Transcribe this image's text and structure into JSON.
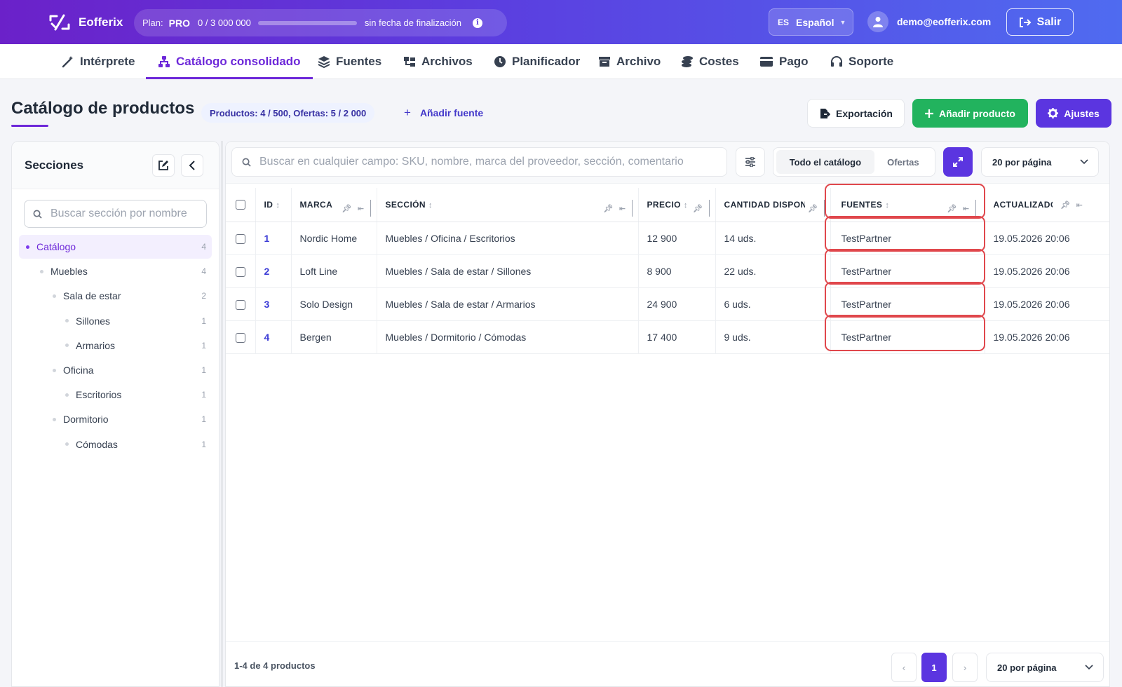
{
  "app": {
    "name": "Eofferix"
  },
  "plan": {
    "label": "Plan:",
    "tier": "PRO",
    "usage": "0  /  3 000 000",
    "usage_fraction": 0,
    "expiry": "sin fecha de finalización"
  },
  "lang": {
    "code": "ES",
    "name": "Español"
  },
  "user": {
    "email": "demo@eofferix.com",
    "logout": "Salir"
  },
  "nav": {
    "items": [
      {
        "label": "Intérprete",
        "icon": "magic-wand-icon"
      },
      {
        "label": "Catálogo consolidado",
        "icon": "sitemap-icon"
      },
      {
        "label": "Fuentes",
        "icon": "layers-icon"
      },
      {
        "label": "Archivos",
        "icon": "folder-tree-icon"
      },
      {
        "label": "Planificador",
        "icon": "clock-icon"
      },
      {
        "label": "Archivo",
        "icon": "archive-box-icon"
      },
      {
        "label": "Costes",
        "icon": "coins-icon"
      },
      {
        "label": "Pago",
        "icon": "credit-card-icon"
      },
      {
        "label": "Soporte",
        "icon": "headset-icon"
      }
    ],
    "active": "Catálogo consolidado"
  },
  "page": {
    "title": "Catálogo de productos",
    "counts": "Productos: 4 / 500, Ofertas: 5 / 2 000",
    "add_source": "Añadir fuente",
    "export": "Exportación",
    "add_product": "Añadir producto",
    "settings": "Ajustes"
  },
  "sidebar": {
    "title": "Secciones",
    "search_placeholder": "Buscar sección por nombre",
    "tree": [
      {
        "label": "Catálogo",
        "count": "4",
        "depth": 0,
        "active": true
      },
      {
        "label": "Muebles",
        "count": "4",
        "depth": 1
      },
      {
        "label": "Sala de estar",
        "count": "2",
        "depth": 2
      },
      {
        "label": "Sillones",
        "count": "1",
        "depth": 3
      },
      {
        "label": "Armarios",
        "count": "1",
        "depth": 3
      },
      {
        "label": "Oficina",
        "count": "1",
        "depth": 2
      },
      {
        "label": "Escritorios",
        "count": "1",
        "depth": 3
      },
      {
        "label": "Dormitorio",
        "count": "1",
        "depth": 2
      },
      {
        "label": "Cómodas",
        "count": "1",
        "depth": 3
      }
    ]
  },
  "toolbar": {
    "search_placeholder": "Buscar en cualquier campo: SKU, nombre, marca del proveedor, sección, comentario",
    "seg_all": "Todo el catálogo",
    "seg_offers": "Ofertas",
    "per_page": "20 por página"
  },
  "table": {
    "headers": {
      "id": "ID",
      "brand": "MARCA",
      "section": "SECCIÓN",
      "price": "PRECIO",
      "qty": "CANTIDAD DISPONIBLE",
      "sources": "FUENTES",
      "updated": "ACTUALIZADO"
    },
    "rows": [
      {
        "id": "1",
        "brand": "Nordic Home",
        "section": "Muebles / Oficina / Escritorios",
        "price": "12 900",
        "qty": "14 uds.",
        "sources": "TestPartner",
        "updated": "19.05.2026 20:06"
      },
      {
        "id": "2",
        "brand": "Loft Line",
        "section": "Muebles / Sala de estar / Sillones",
        "price": "8 900",
        "qty": "22 uds.",
        "sources": "TestPartner",
        "updated": "19.05.2026 20:06"
      },
      {
        "id": "3",
        "brand": "Solo Design",
        "section": "Muebles / Sala de estar / Armarios",
        "price": "24 900",
        "qty": "6 uds.",
        "sources": "TestPartner",
        "updated": "19.05.2026 20:06"
      },
      {
        "id": "4",
        "brand": "Bergen",
        "section": "Muebles / Dormitorio / Cómodas",
        "price": "17 400",
        "qty": "9 uds.",
        "sources": "TestPartner",
        "updated": "19.05.2026 20:06"
      }
    ]
  },
  "footer": {
    "info": "1-4 de 4 productos",
    "prev": "‹",
    "page": "1",
    "next": "›",
    "per_page": "20 por página"
  },
  "colors": {
    "brand": "#6d28d9",
    "accent": "#5b35e0",
    "success": "#22b35e",
    "highlight": "#e0474c"
  }
}
